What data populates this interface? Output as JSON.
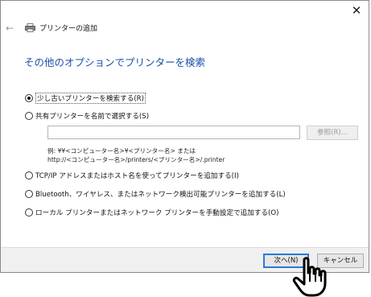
{
  "window": {
    "title": "プリンターの追加",
    "close_glyph": "✕",
    "back_glyph": "←"
  },
  "heading": "その他のオプションでプリンターを検索",
  "options": [
    {
      "label": "少し古いプリンターを検索する(R)",
      "checked": true
    },
    {
      "label": "共有プリンターを名前で選択する(S)",
      "checked": false
    },
    {
      "label": "TCP/IP アドレスまたはホスト名を使ってプリンターを追加する(I)",
      "checked": false
    },
    {
      "label": "Bluetooth、ワイヤレス、またはネットワーク検出可能プリンターを追加する(L)",
      "checked": false
    },
    {
      "label": "ローカル プリンターまたはネットワーク プリンターを手動設定で追加する(O)",
      "checked": false
    }
  ],
  "share_input": {
    "value": ""
  },
  "browse_label": "参照(R)...",
  "example_lines": [
    "例: ¥¥<コンピューター名>¥<プリンター名> または",
    "http://<コンピューター名>/printers/<プリンター名>/.printer"
  ],
  "buttons": {
    "next": "次へ(N)",
    "cancel": "キャンセル"
  },
  "colors": {
    "heading": "#1a4fa8",
    "focus_border": "#2b78d8"
  },
  "icons": [
    "close-icon",
    "back-arrow-icon",
    "printer-icon",
    "hand-cursor-icon"
  ]
}
